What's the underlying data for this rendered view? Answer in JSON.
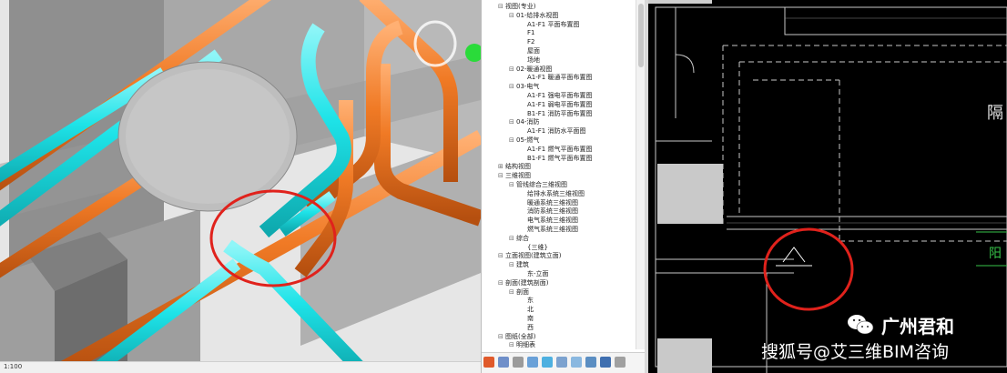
{
  "view3d": {
    "status_text": "1:100"
  },
  "browser": {
    "tree": [
      {
        "label": "视图(专业)",
        "depth": 0,
        "exp": "⊟"
      },
      {
        "label": "01-给排水视图",
        "depth": 1,
        "exp": "⊟"
      },
      {
        "label": "A1-F1 平面布置图",
        "depth": 2,
        "exp": ""
      },
      {
        "label": "F1",
        "depth": 2,
        "exp": ""
      },
      {
        "label": "F2",
        "depth": 2,
        "exp": ""
      },
      {
        "label": "屋面",
        "depth": 2,
        "exp": ""
      },
      {
        "label": "场地",
        "depth": 2,
        "exp": ""
      },
      {
        "label": "02-暖通视图",
        "depth": 1,
        "exp": "⊟"
      },
      {
        "label": "A1-F1 暖通平面布置图",
        "depth": 2,
        "exp": ""
      },
      {
        "label": "03-电气",
        "depth": 1,
        "exp": "⊟"
      },
      {
        "label": "A1-F1 强电平面布置图",
        "depth": 2,
        "exp": ""
      },
      {
        "label": "A1-F1 弱电平面布置图",
        "depth": 2,
        "exp": ""
      },
      {
        "label": "B1-F1 消防平面布置图",
        "depth": 2,
        "exp": ""
      },
      {
        "label": "04-消防",
        "depth": 1,
        "exp": "⊟"
      },
      {
        "label": "A1-F1 消防水平面图",
        "depth": 2,
        "exp": ""
      },
      {
        "label": "05-燃气",
        "depth": 1,
        "exp": "⊟"
      },
      {
        "label": "A1-F1 燃气平面布置图",
        "depth": 2,
        "exp": ""
      },
      {
        "label": "B1-F1 燃气平面布置图",
        "depth": 2,
        "exp": ""
      },
      {
        "label": "结构视图",
        "depth": 0,
        "exp": "⊞"
      },
      {
        "label": "三维视图",
        "depth": 0,
        "exp": "⊟"
      },
      {
        "label": "管线综合三维视图",
        "depth": 1,
        "exp": "⊟"
      },
      {
        "label": "给排水系统三维视图",
        "depth": 2,
        "exp": ""
      },
      {
        "label": "暖通系统三维视图",
        "depth": 2,
        "exp": ""
      },
      {
        "label": "消防系统三维视图",
        "depth": 2,
        "exp": ""
      },
      {
        "label": "电气系统三维视图",
        "depth": 2,
        "exp": ""
      },
      {
        "label": "燃气系统三维视图",
        "depth": 2,
        "exp": ""
      },
      {
        "label": "综合",
        "depth": 1,
        "exp": "⊟"
      },
      {
        "label": "{三维}",
        "depth": 2,
        "exp": ""
      },
      {
        "label": "立面视图(建筑立面)",
        "depth": 0,
        "exp": "⊟"
      },
      {
        "label": "建筑",
        "depth": 1,
        "exp": "⊟"
      },
      {
        "label": "东-立面",
        "depth": 2,
        "exp": ""
      },
      {
        "label": "剖面(建筑剖面)",
        "depth": 0,
        "exp": "⊟"
      },
      {
        "label": "剖面",
        "depth": 1,
        "exp": "⊟"
      },
      {
        "label": "东",
        "depth": 2,
        "exp": ""
      },
      {
        "label": "北",
        "depth": 2,
        "exp": ""
      },
      {
        "label": "南",
        "depth": 2,
        "exp": ""
      },
      {
        "label": "西",
        "depth": 2,
        "exp": ""
      },
      {
        "label": "图纸(全部)",
        "depth": 0,
        "exp": "⊟"
      },
      {
        "label": "明细表",
        "depth": 1,
        "exp": "⊟"
      }
    ]
  },
  "plan": {
    "side_text_1": "隔",
    "side_text_2": "阳"
  },
  "watermark": {
    "brand": "广州君和",
    "source": "搜狐号@艾三维BIM咨询"
  },
  "colors": {
    "cyan_pipe": "#1ee3e8",
    "orange_pipe": "#f07a25",
    "highlight": "#e0221c",
    "plan_line": "#c8c8c8"
  }
}
